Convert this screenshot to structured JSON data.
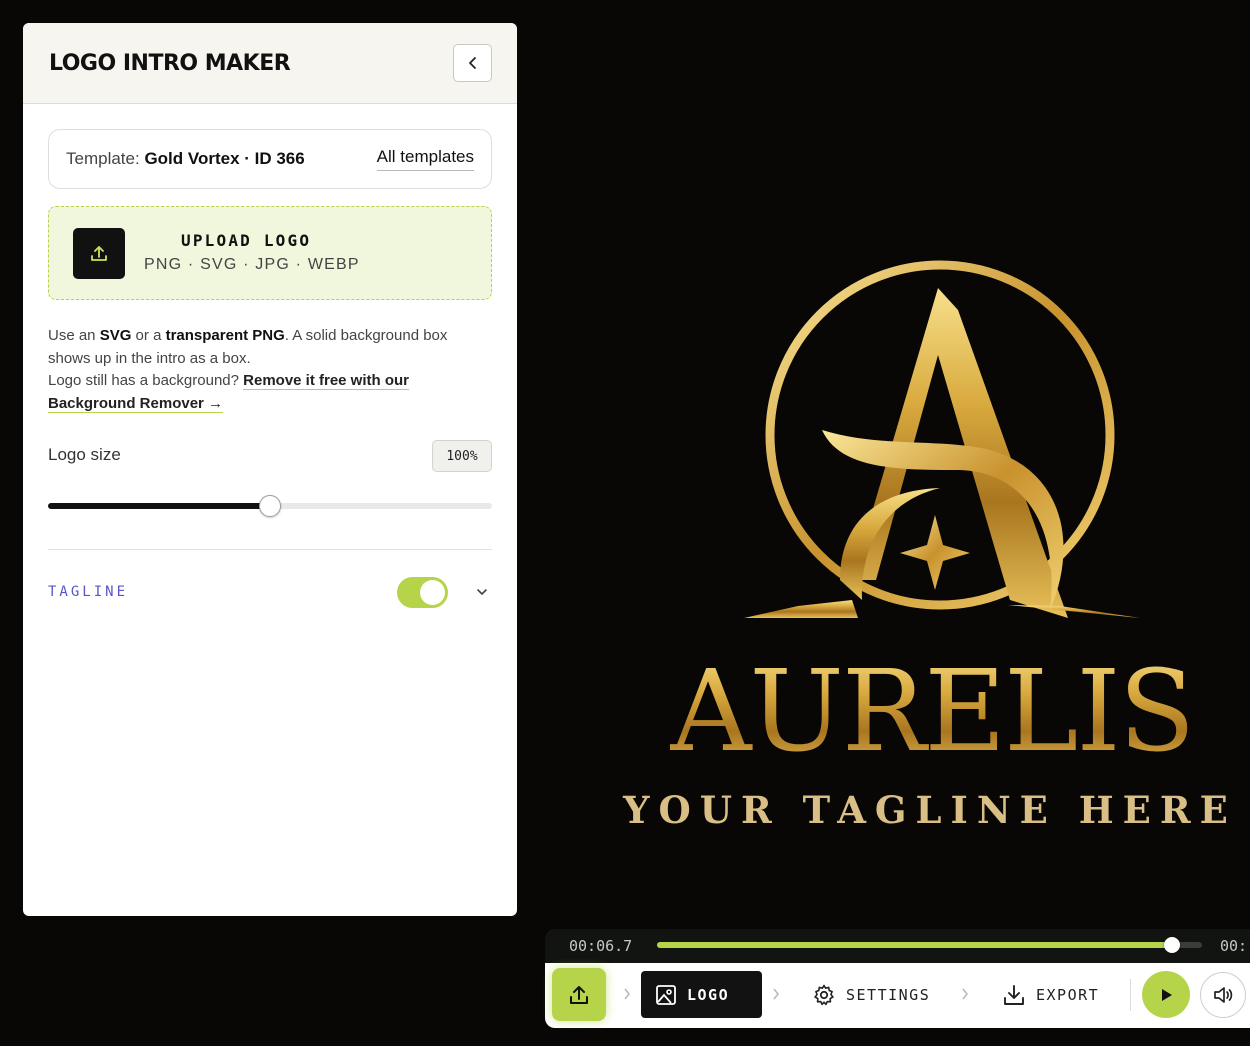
{
  "panel": {
    "title": "LOGO INTRO MAKER",
    "template": {
      "label": "Template:",
      "name": "Gold Vortex · ID 366",
      "all_templates": "All templates"
    },
    "upload": {
      "title": "UPLOAD LOGO",
      "formats": "PNG · SVG · JPG · WEBP"
    },
    "help": {
      "p1_a": "Use an ",
      "p1_b": "SVG",
      "p1_c": " or a ",
      "p1_d": "transparent PNG",
      "p1_e": ". A solid background box shows up in the intro as a box.",
      "p2_a": "Logo still has a background? ",
      "p2_link": "Remove it free with our Background Remover →"
    },
    "logo_size": {
      "label": "Logo size",
      "value_text": "100%",
      "slider_fraction": 0.5
    },
    "tagline": {
      "label": "TAGLINE",
      "enabled": true
    }
  },
  "preview": {
    "brand": "AURELIS",
    "tagline": "YOUR TAGLINE HERE",
    "gold": "#d4a63c"
  },
  "timeline": {
    "current": "00:06.7",
    "end": "00:",
    "progress_fraction": 0.945
  },
  "toolbar": {
    "logo": "LOGO",
    "settings": "SETTINGS",
    "export": "EXPORT"
  },
  "colors": {
    "accent": "#b5d449",
    "tagline_label": "#5a55c9",
    "dark": "#121212"
  }
}
